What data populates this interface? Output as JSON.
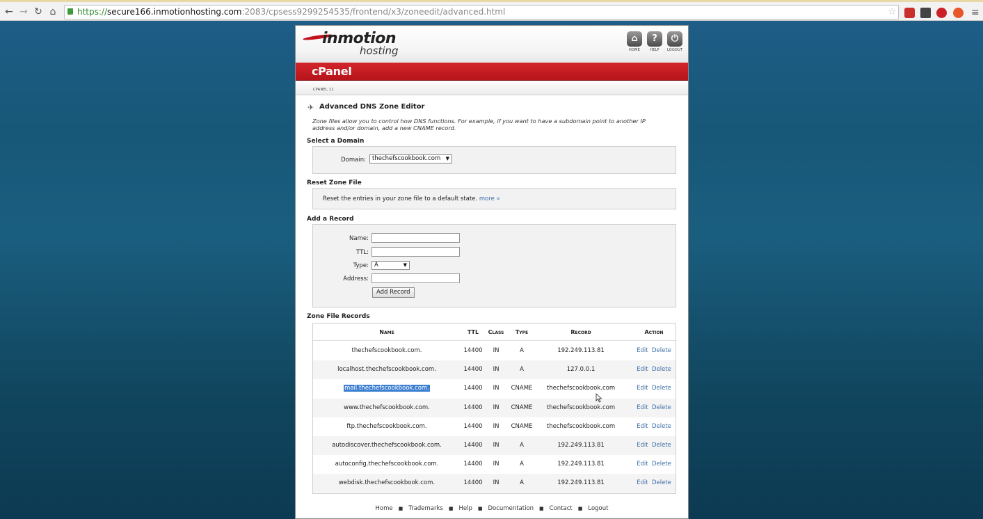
{
  "browser": {
    "url_scheme": "https://",
    "url_host": "secure166.inmotionhosting.com",
    "url_rest": ":2083/cpsess9299254535/frontend/x3/zoneedit/advanced.html"
  },
  "brand": {
    "logo_top": "inmotion",
    "logo_bottom": "hosting",
    "product": "cPanel",
    "version": "CPANEL 11",
    "accent_red": "#c3141d",
    "link_blue": "#3d6ea8"
  },
  "top_icons": [
    {
      "label": "HOME",
      "icon": "home-icon"
    },
    {
      "label": "HELP",
      "icon": "help-icon"
    },
    {
      "label": "LOGOUT",
      "icon": "logout-icon"
    }
  ],
  "page": {
    "title": "Advanced DNS Zone Editor",
    "description": "Zone files allow you to control how DNS functions. For example, if you want to have a subdomain point to another IP address and/or domain, add a new CNAME record."
  },
  "select_domain": {
    "heading": "Select a Domain",
    "label": "Domain:",
    "value": "thechefscookbook.com"
  },
  "reset": {
    "heading": "Reset Zone File",
    "text": "Reset the entries in your zone file to a default state.",
    "more": "more »"
  },
  "add_record": {
    "heading": "Add a Record",
    "name_label": "Name:",
    "name_value": "",
    "ttl_label": "TTL:",
    "ttl_value": "",
    "type_label": "Type:",
    "type_value": "A",
    "address_label": "Address:",
    "address_value": "",
    "button": "Add Record"
  },
  "zone_records": {
    "heading": "Zone File Records",
    "columns": [
      "Name",
      "TTL",
      "Class",
      "Type",
      "Record",
      "Action"
    ],
    "rows": [
      {
        "name": "thechefscookbook.com.",
        "ttl": "14400",
        "class": "IN",
        "type": "A",
        "record": "192.249.113.81"
      },
      {
        "name": "localhost.thechefscookbook.com.",
        "ttl": "14400",
        "class": "IN",
        "type": "A",
        "record": "127.0.0.1"
      },
      {
        "name": "mail.thechefscookbook.com.",
        "ttl": "14400",
        "class": "IN",
        "type": "CNAME",
        "record": "thechefscookbook.com"
      },
      {
        "name": "www.thechefscookbook.com.",
        "ttl": "14400",
        "class": "IN",
        "type": "CNAME",
        "record": "thechefscookbook.com"
      },
      {
        "name": "ftp.thechefscookbook.com.",
        "ttl": "14400",
        "class": "IN",
        "type": "CNAME",
        "record": "thechefscookbook.com"
      },
      {
        "name": "autodiscover.thechefscookbook.com.",
        "ttl": "14400",
        "class": "IN",
        "type": "A",
        "record": "192.249.113.81"
      },
      {
        "name": "autoconfig.thechefscookbook.com.",
        "ttl": "14400",
        "class": "IN",
        "type": "A",
        "record": "192.249.113.81"
      },
      {
        "name": "webdisk.thechefscookbook.com.",
        "ttl": "14400",
        "class": "IN",
        "type": "A",
        "record": "192.249.113.81"
      }
    ],
    "edit_label": "Edit",
    "delete_label": "Delete"
  },
  "footer": {
    "links": [
      "Home",
      "Trademarks",
      "Help",
      "Documentation",
      "Contact",
      "Logout"
    ],
    "separator": "■"
  }
}
